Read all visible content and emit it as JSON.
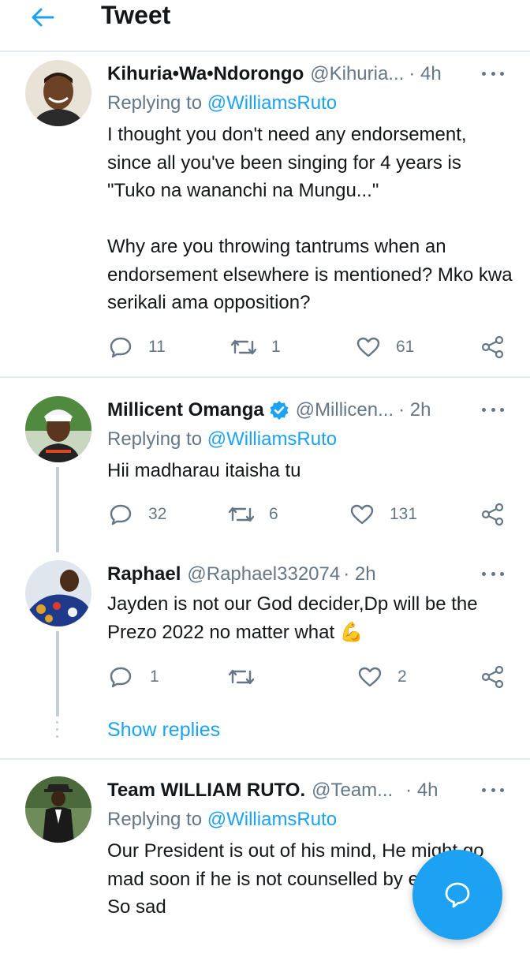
{
  "header": {
    "title": "Tweet",
    "back_icon": "arrow-left-icon"
  },
  "colors": {
    "accent": "#1da1f2",
    "muted": "#657786",
    "divider": "#e6ecf0"
  },
  "tweets": [
    {
      "name": "Kihuria•Wa•Ndorongo",
      "handle": "@Kihuria...",
      "time": "· 4h",
      "replying_prefix": "Replying to ",
      "replying_to": "@WilliamsRuto",
      "text": "I thought you don't need any endorsement, since all you've been singing for 4 years is \"Tuko na wananchi na Mungu...\"\n\nWhy are you throwing tantrums when an endorsement elsewhere is mentioned? Mko kwa serikali ama opposition?",
      "replies": "11",
      "retweets": "1",
      "likes": "61"
    },
    {
      "name": "Millicent Omanga",
      "verified": true,
      "handle": "@Millicen...",
      "time": "· 2h",
      "replying_prefix": "Replying to ",
      "replying_to": "@WilliamsRuto",
      "text": "Hii madharau itaisha tu",
      "replies": "32",
      "retweets": "6",
      "likes": "131"
    },
    {
      "name": "Raphael",
      "handle": "@Raphael332074",
      "time": "· 2h",
      "text": "Jayden is not our God decider,Dp will be the Prezo 2022 no matter what",
      "emoji": "💪",
      "replies": "1",
      "retweets": "",
      "likes": "2"
    },
    {
      "name": "Team WILLIAM RUTO.",
      "handle": "@Team...",
      "time": "· 4h",
      "replying_prefix": "Replying to ",
      "replying_to": "@WilliamsRuto",
      "text": "Our President is out of his mind, He might go mad soon if he is not counselled by elders.\nSo sad"
    }
  ],
  "show_replies": "Show replies",
  "fab_icon": "compose-reply-icon"
}
